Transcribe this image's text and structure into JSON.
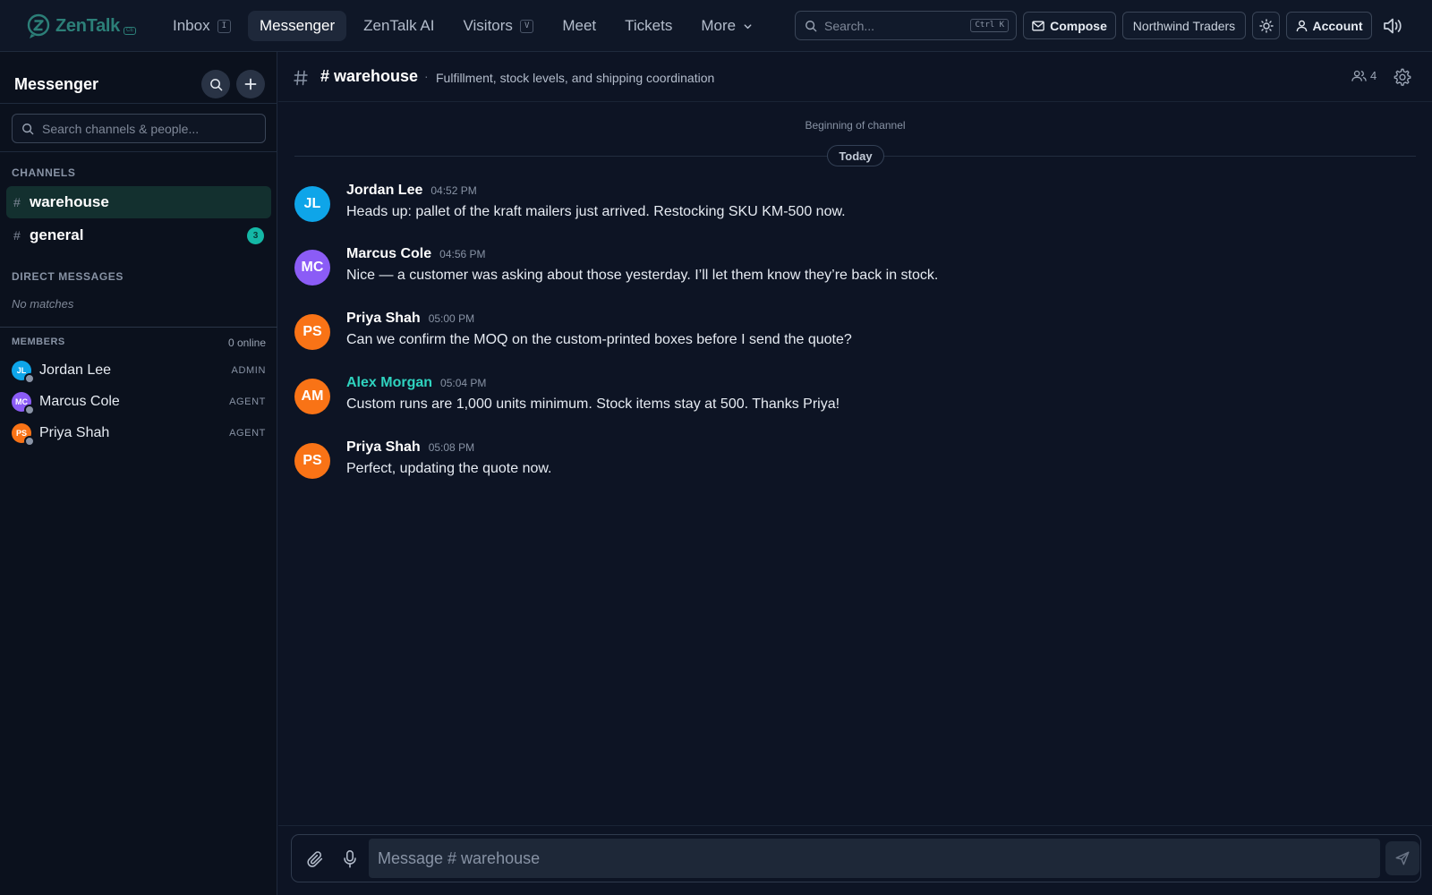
{
  "app": {
    "name": "ZenTalk",
    "tag": "CE",
    "colors": {
      "accent": "#14b8a6",
      "self_author": "#2fd3bf",
      "background": "#0d1424"
    }
  },
  "nav": {
    "items": [
      {
        "label": "Inbox",
        "kbd": "I"
      },
      {
        "label": "Messenger"
      },
      {
        "label": "ZenTalk AI"
      },
      {
        "label": "Visitors",
        "kbd": "V"
      },
      {
        "label": "Meet"
      },
      {
        "label": "Tickets"
      },
      {
        "label": "More"
      }
    ],
    "active": "Messenger"
  },
  "toolbar": {
    "search_placeholder": "Search...",
    "search_shortcut": "Ctrl K",
    "compose_label": "Compose",
    "org_label": "Northwind Traders",
    "account_label": "Account"
  },
  "sidebar": {
    "title": "Messenger",
    "search_placeholder": "Search channels & people...",
    "channels_label": "CHANNELS",
    "channels": [
      {
        "name": "warehouse",
        "active": true
      },
      {
        "name": "general",
        "unread": "3"
      }
    ],
    "dm_label": "DIRECT MESSAGES",
    "dm_empty": "No matches",
    "members_label": "MEMBERS",
    "members_online": "0 online",
    "members": [
      {
        "initials": "JL",
        "name": "Jordan Lee",
        "role": "ADMIN",
        "color": "#0ea5e9"
      },
      {
        "initials": "MC",
        "name": "Marcus Cole",
        "role": "AGENT",
        "color": "#8b5cf6"
      },
      {
        "initials": "PS",
        "name": "Priya Shah",
        "role": "AGENT",
        "color": "#f97316"
      }
    ]
  },
  "channel": {
    "name": "# warehouse",
    "separator": "·",
    "description": "Fulfillment, stock levels, and shipping coordination",
    "member_count": "4",
    "beginning": "Beginning of channel",
    "day_label": "Today"
  },
  "messages": [
    {
      "initials": "JL",
      "author": "Jordan Lee",
      "time": "04:52 PM",
      "text": "Heads up: pallet of the kraft mailers just arrived. Restocking SKU KM-500 now.",
      "color": "#0ea5e9"
    },
    {
      "initials": "MC",
      "author": "Marcus Cole",
      "time": "04:56 PM",
      "text": "Nice — a customer was asking about those yesterday. I’ll let them know they’re back in stock.",
      "color": "#8b5cf6"
    },
    {
      "initials": "PS",
      "author": "Priya Shah",
      "time": "05:00 PM",
      "text": "Can we confirm the MOQ on the custom-printed boxes before I send the quote?",
      "color": "#f97316"
    },
    {
      "initials": "AM",
      "author": "Alex Morgan",
      "time": "05:04 PM",
      "text": "Custom runs are 1,000 units minimum. Stock items stay at 500. Thanks Priya!",
      "color": "#f97316"
    },
    {
      "initials": "PS",
      "author": "Priya Shah",
      "time": "05:08 PM",
      "text": "Perfect, updating the quote now.",
      "color": "#f97316"
    }
  ],
  "composer": {
    "placeholder": "Message # warehouse"
  }
}
